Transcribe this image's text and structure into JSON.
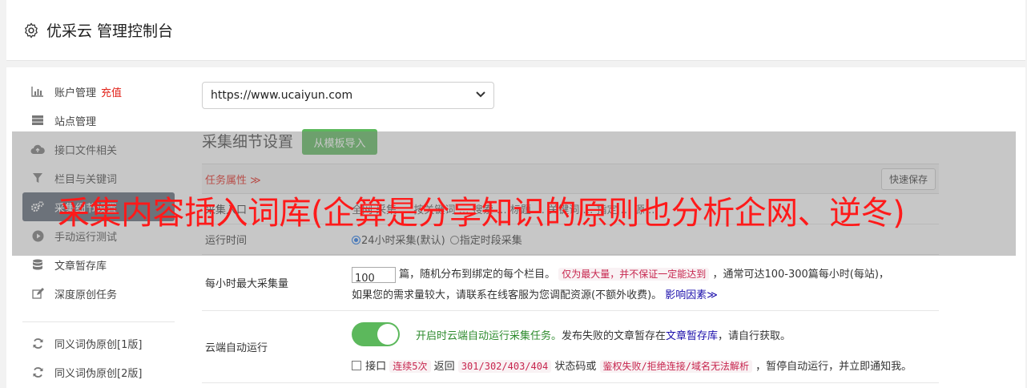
{
  "header": {
    "title": "优采云 管理控制台",
    "icon": "gear-icon"
  },
  "sidebar": {
    "items": [
      {
        "label": "账户管理",
        "badge": "充值",
        "icon": "bar-chart-icon"
      },
      {
        "label": "站点管理",
        "icon": "server-icon"
      },
      {
        "label": "接口文件相关",
        "icon": "cloud-upload-icon"
      },
      {
        "label": "栏目与关键词",
        "icon": "filter-icon"
      },
      {
        "label": "采集细节设置",
        "icon": "cogs-icon",
        "active": true
      },
      {
        "label": "手动运行测试",
        "icon": "play-circle-icon"
      },
      {
        "label": "文章暂存库",
        "icon": "database-icon"
      },
      {
        "label": "深度原创任务",
        "icon": "edit-icon"
      },
      {
        "label": "同义词伪原创[1版]",
        "icon": "refresh-icon"
      },
      {
        "label": "同义词伪原创[2版]",
        "icon": "refresh-icon"
      }
    ]
  },
  "site_select": {
    "value": "https://www.ucaiyun.com"
  },
  "section": {
    "title": "采集细节设置",
    "template_button": "从模板导入"
  },
  "table": {
    "head": {
      "attr_label": "任务属性 ≫",
      "quick_save": "快速保存"
    },
    "rows": {
      "entry": {
        "label": "采集入口",
        "content": "全网 采集 … 按关键词 … 搜索 … 标题 … 关键词 … 指定 … 源 …"
      },
      "runtime": {
        "label": "运行时间",
        "opt1": "24小时采集(默认)",
        "opt2": "指定时段采集"
      },
      "max": {
        "label": "每小时最大采集量",
        "value": "100",
        "text1": "篇，随机分布到绑定的每个栏目。",
        "pill1": "仅为最大量，并不保证一定能达到",
        "text2": "，通常可达100-300篇每小时(每站)，",
        "text3": "如果您的需求量较大，请联系在线客服为您调配资源(不额外收费)。",
        "link": "影响因素≫"
      },
      "cloud": {
        "label": "云端自动运行",
        "green": "开启时云端自动运行采集任务。",
        "text1": "发布失败的文章暂存在",
        "link": "文章暂存库",
        "text2": "，请自行获取。",
        "chk_label": "接口",
        "pill1": "连续5次",
        "text3": "返回",
        "pill2": "301/302/403/404",
        "text4": "状态码或",
        "pill3": "鉴权失败/拒绝连接/域名无法解析",
        "text5": "，暂停自动运行，并立即通知我。"
      }
    }
  },
  "overlay": {
    "text": "采集内容插入词库(企算是分享知识的原则也分析企网、逆冬)"
  }
}
